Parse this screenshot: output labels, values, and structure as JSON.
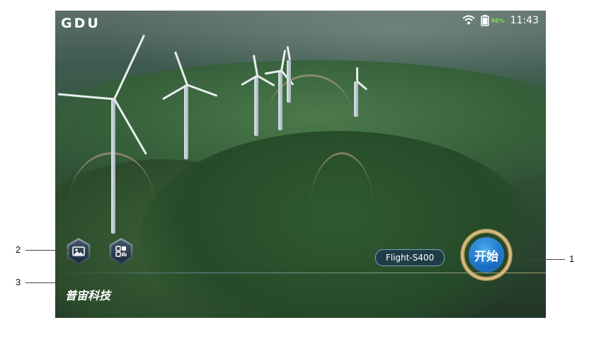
{
  "status_bar": {
    "logo": "GDU",
    "battery_percent": "98%",
    "time": "11:43",
    "icons": [
      "wifi-icon",
      "battery-icon"
    ]
  },
  "buttons": {
    "gallery_icon": "image-icon",
    "qr_icon": "qr-code-icon"
  },
  "brand_text": "普宙科技",
  "device_name": "Flight-S400",
  "start_label": "开始",
  "callouts": {
    "one": "1",
    "two": "2",
    "three": "3"
  },
  "colors": {
    "accent_blue": "#1a6fc4",
    "gold_ring": "#e0c98c",
    "battery_green": "#7ddc4a"
  }
}
